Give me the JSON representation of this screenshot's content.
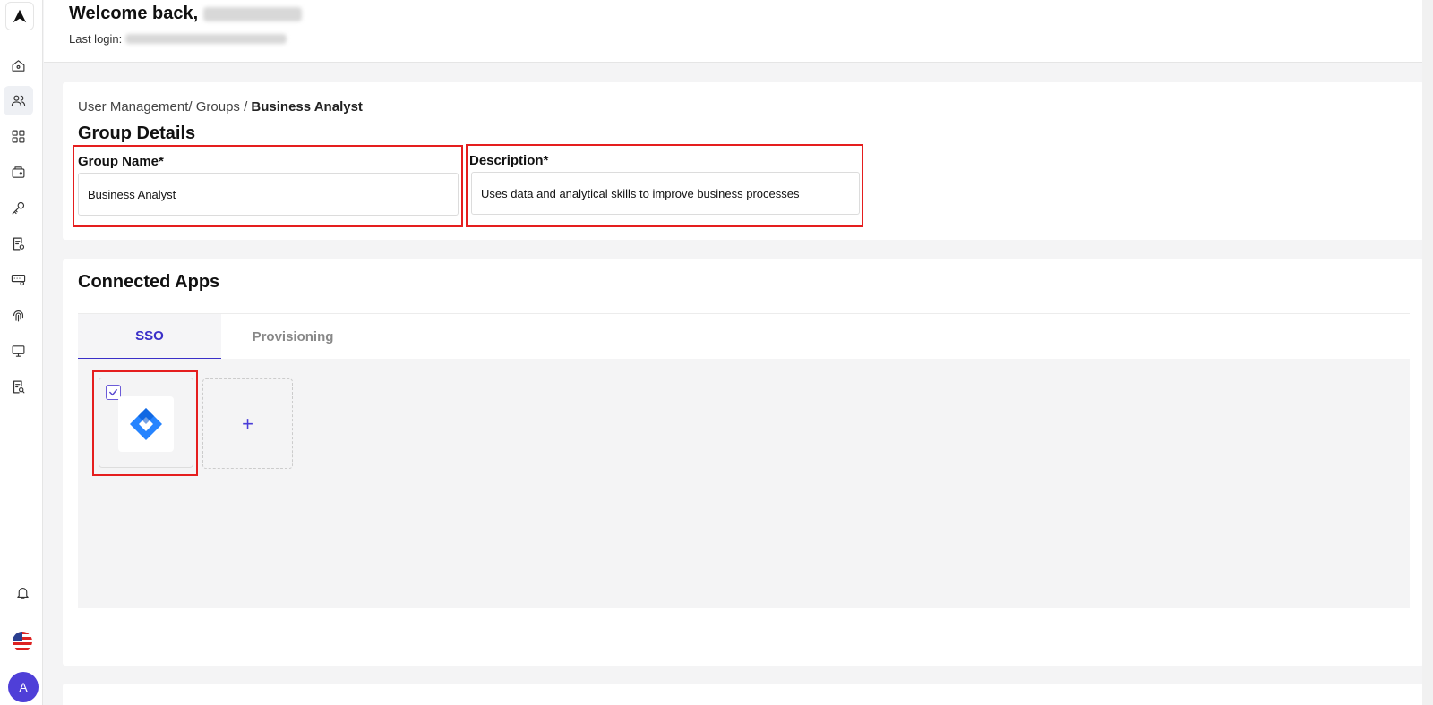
{
  "header": {
    "welcome_prefix": "Welcome back,",
    "last_login_label": "Last login:"
  },
  "breadcrumb": {
    "path": "User Management/ Groups / ",
    "current": "Business Analyst"
  },
  "group_details": {
    "title": "Group Details",
    "name_label": "Group Name*",
    "name_value": "Business Analyst",
    "description_label": "Description*",
    "description_value": "Uses data and analytical skills to improve business processes"
  },
  "connected_apps": {
    "title": "Connected Apps",
    "tabs": [
      {
        "label": "SSO",
        "active": true
      },
      {
        "label": "Provisioning",
        "active": false
      }
    ],
    "add_label": "+"
  },
  "user": {
    "avatar_initial": "A"
  },
  "colors": {
    "accent": "#3a2fc8",
    "highlight": "#e51e1e",
    "app_logo": "#2684ff"
  },
  "icons": [
    "home-icon",
    "users-icon",
    "apps-grid-icon",
    "wallet-icon",
    "key-icon",
    "report-settings-icon",
    "device-key-icon",
    "fingerprint-icon",
    "monitor-icon",
    "audit-search-icon",
    "bell-icon",
    "us-flag-icon"
  ]
}
